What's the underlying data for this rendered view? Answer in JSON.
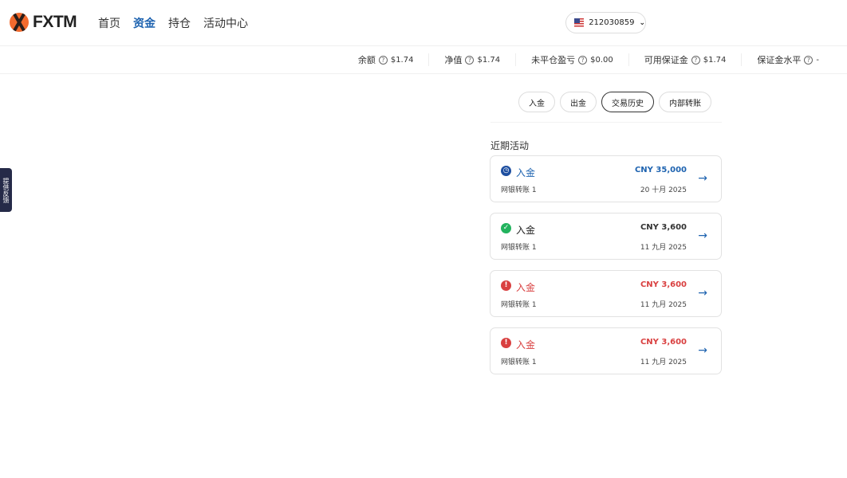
{
  "brand": "FXTM",
  "nav": [
    "首页",
    "资金",
    "持仓",
    "活动中心"
  ],
  "account": {
    "number": "212030859"
  },
  "stats": [
    {
      "label": "余额",
      "value": "$1.74"
    },
    {
      "label": "净值",
      "value": "$1.74"
    },
    {
      "label": "未平仓盈亏",
      "value": "$0.00"
    },
    {
      "label": "可用保证金",
      "value": "$1.74"
    },
    {
      "label": "保证金水平",
      "value": "-"
    }
  ],
  "tabs": [
    "入金",
    "出金",
    "交易历史",
    "内部转账"
  ],
  "section_title": "近期活动",
  "feedback": "提供反馈",
  "activities": [
    {
      "type": "入金",
      "method": "网银转账 1",
      "amount": "CNY 35,000",
      "date": "20 十月 2025",
      "status": "pending",
      "color": "#1e63b0"
    },
    {
      "type": "入金",
      "method": "网银转账 1",
      "amount": "CNY 3,600",
      "date": "11 九月 2025",
      "status": "success",
      "color": "#333333"
    },
    {
      "type": "入金",
      "method": "网银转账 1",
      "amount": "CNY 3,600",
      "date": "11 九月 2025",
      "status": "failed",
      "color": "#d94040"
    },
    {
      "type": "入金",
      "method": "网银转账 1",
      "amount": "CNY 3,600",
      "date": "11 九月 2025",
      "status": "failed",
      "color": "#d94040"
    }
  ]
}
